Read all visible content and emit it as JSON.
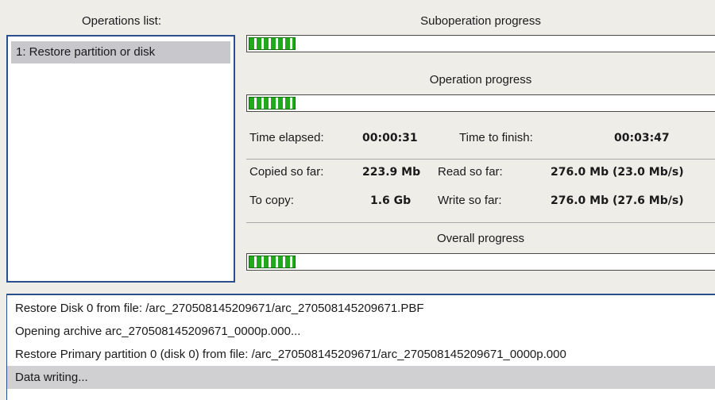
{
  "operations": {
    "header": "Operations list:",
    "items": [
      {
        "label": "1: Restore partition or disk"
      }
    ]
  },
  "suboperation": {
    "title": "Suboperation progress",
    "progress": 0.1
  },
  "operation": {
    "title": "Operation progress",
    "progress": 0.1
  },
  "stats": {
    "time_elapsed_label": "Time elapsed:",
    "time_elapsed": "00:00:31",
    "time_to_finish_label": "Time to finish:",
    "time_to_finish": "00:03:47",
    "copied_label": "Copied so far:",
    "copied": "223.9 Mb",
    "read_label": "Read so far:",
    "read": "276.0 Mb (23.0 Mb/s)",
    "to_copy_label": "To copy:",
    "to_copy": "1.6 Gb",
    "write_label": "Write so far:",
    "write": "276.0 Mb (27.6 Mb/s)"
  },
  "overall": {
    "title": "Overall progress",
    "progress": 0.1
  },
  "log": {
    "lines": [
      "Restore Disk 0 from file: /arc_270508145209671/arc_270508145209671.PBF",
      "Opening archive arc_270508145209671_0000p.000...",
      "Restore Primary partition 0 (disk 0) from file: /arc_270508145209671/arc_270508145209671_0000p.000",
      "Data writing..."
    ],
    "selected_index": 3
  }
}
